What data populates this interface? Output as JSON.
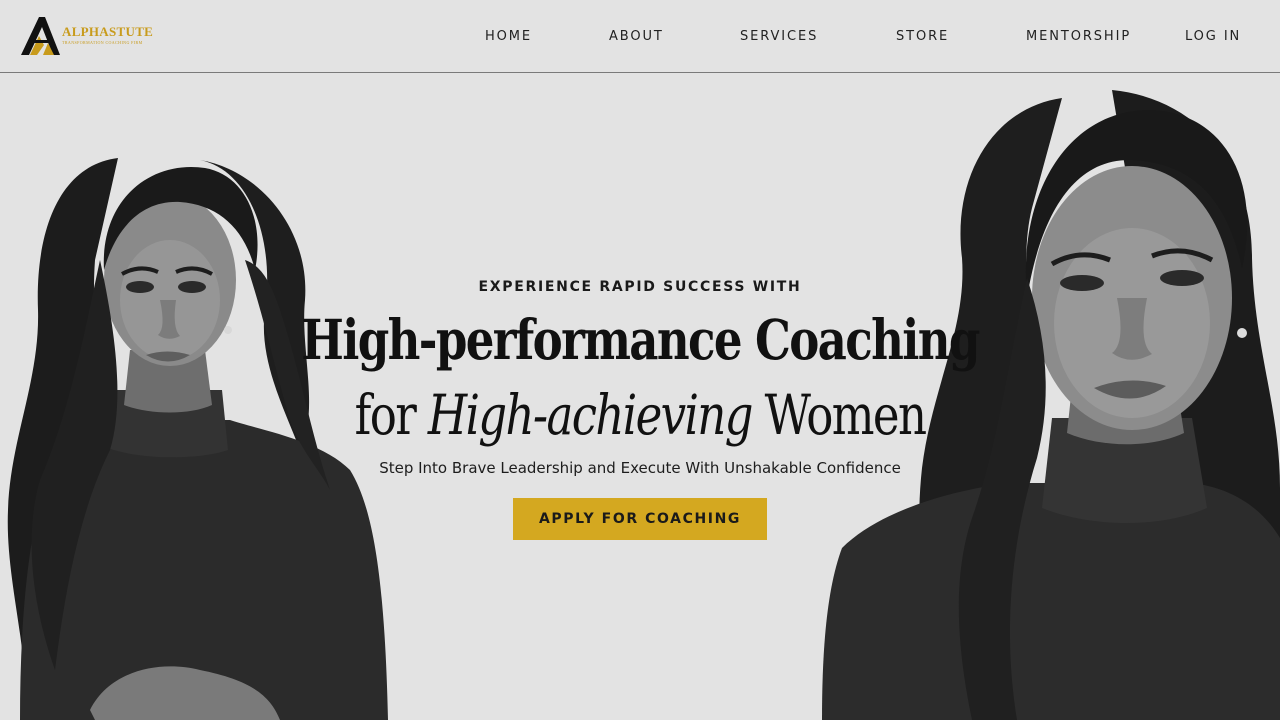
{
  "brand": {
    "name": "ALPHASTUTE",
    "tagline": "TRANSFORMATION COACHING FIRM",
    "gold": "#c89b1c",
    "logo_icon": "a-monogram-icon"
  },
  "nav": {
    "items": [
      {
        "label": "HOME"
      },
      {
        "label": "ABOUT"
      },
      {
        "label": "SERVICES"
      },
      {
        "label": "STORE"
      },
      {
        "label": "MENTORSHIP"
      },
      {
        "label": "LOG IN"
      }
    ]
  },
  "hero": {
    "eyebrow": "EXPERIENCE RAPID SUCCESS WITH",
    "headline_line1": "High-performance Coaching",
    "headline_line2_pre": "for ",
    "headline_line2_italic": "High-achieving",
    "headline_line2_post": " Women",
    "subheading": "Step Into Brave Leadership and Execute With Unshakable Confidence",
    "cta_label": "APPLY FOR COACHING",
    "cta_color": "#d4a820",
    "background": "#e3e3e3"
  },
  "images": {
    "left_portrait": "woman-portrait-black-white",
    "right_portrait": "woman-portrait-black-white-closeup"
  }
}
